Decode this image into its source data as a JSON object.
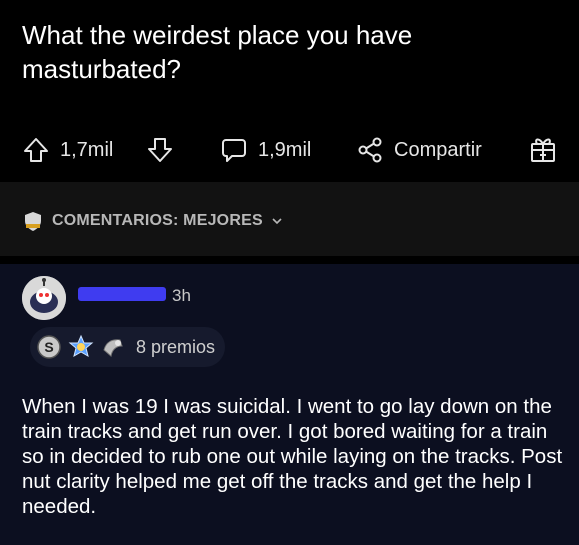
{
  "post": {
    "title": "What the weirdest place you have masturbated?",
    "upvotes": "1,7mil",
    "comments": "1,9mil",
    "share_label": "Compartir"
  },
  "sort": {
    "label": "COMENTARIOS: MEJORES"
  },
  "comment": {
    "time": "3h",
    "awards": "8 premios",
    "text": "When I was 19 I was suicidal. I went to go lay down on the train tracks and get run over. I got bored waiting for a train so in decided to rub one out while laying on the tracks. Post nut clarity helped me get off the tracks and get the help I needed."
  },
  "icons": [
    "upvote-icon",
    "downvote-icon",
    "comment-icon",
    "share-icon",
    "gift-icon",
    "shield-icon",
    "chevron-down-icon",
    "silver-award-icon",
    "wholesome-award-icon",
    "helpful-award-icon"
  ],
  "colors": {
    "background": "#000000",
    "sort_band": "#121212",
    "comment_card": "#0c0f20",
    "username_redaction": "#3f3cf0"
  }
}
